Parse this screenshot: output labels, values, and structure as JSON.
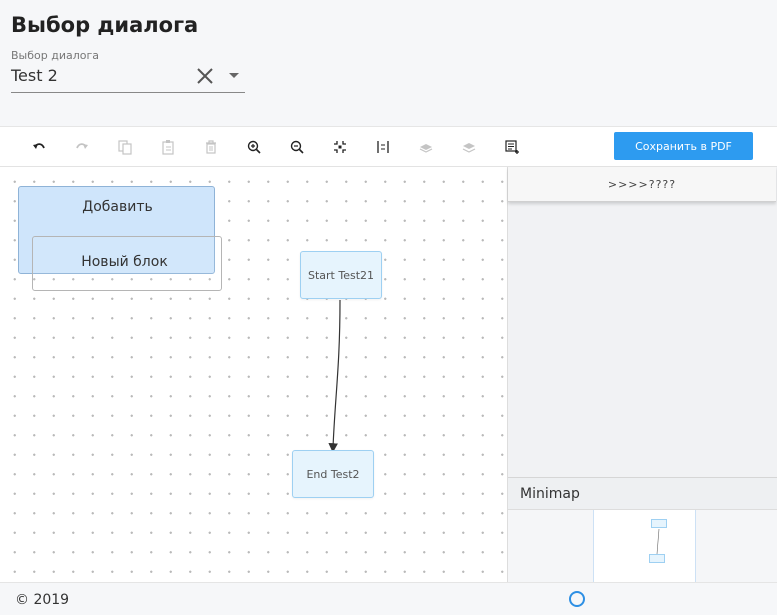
{
  "header": {
    "title": "Выбор диалога",
    "select_label": "Выбор диалога",
    "select_value": "Test 2"
  },
  "toolbar": {
    "buttons": [
      {
        "name": "undo-button",
        "icon": "undo-icon",
        "enabled": true
      },
      {
        "name": "redo-button",
        "icon": "redo-icon",
        "enabled": false
      },
      {
        "name": "copy-button",
        "icon": "copy-icon",
        "enabled": false
      },
      {
        "name": "paste-button",
        "icon": "paste-icon",
        "enabled": false
      },
      {
        "name": "delete-button",
        "icon": "trash-icon",
        "enabled": false
      },
      {
        "name": "zoom-in-button",
        "icon": "zoom-in-icon",
        "enabled": true
      },
      {
        "name": "zoom-out-button",
        "icon": "zoom-out-icon",
        "enabled": true
      },
      {
        "name": "fit-view-button",
        "icon": "fit-icon",
        "enabled": true
      },
      {
        "name": "actual-size-button",
        "icon": "actual-size-icon",
        "enabled": true
      },
      {
        "name": "send-back-button",
        "icon": "send-back-icon",
        "enabled": false
      },
      {
        "name": "bring-front-button",
        "icon": "bring-front-icon",
        "enabled": false
      },
      {
        "name": "select-all-button",
        "icon": "select-all-icon",
        "enabled": true
      }
    ],
    "pdf_label": "Сохранить в PDF"
  },
  "canvas": {
    "menu_add": "Добавить",
    "menu_new_block": "Новый блок",
    "nodes": {
      "start": "Start Test21",
      "end": "End Test2"
    }
  },
  "panel": {
    "header": ">>>>????",
    "minimap_title": "Minimap"
  },
  "footer": {
    "copyright": "© 2019"
  },
  "colors": {
    "accent": "#2d9bf0",
    "node_fill": "#e6f4fd",
    "node_border": "#9ed0f2",
    "menu_fill": "#cfe5fb"
  }
}
